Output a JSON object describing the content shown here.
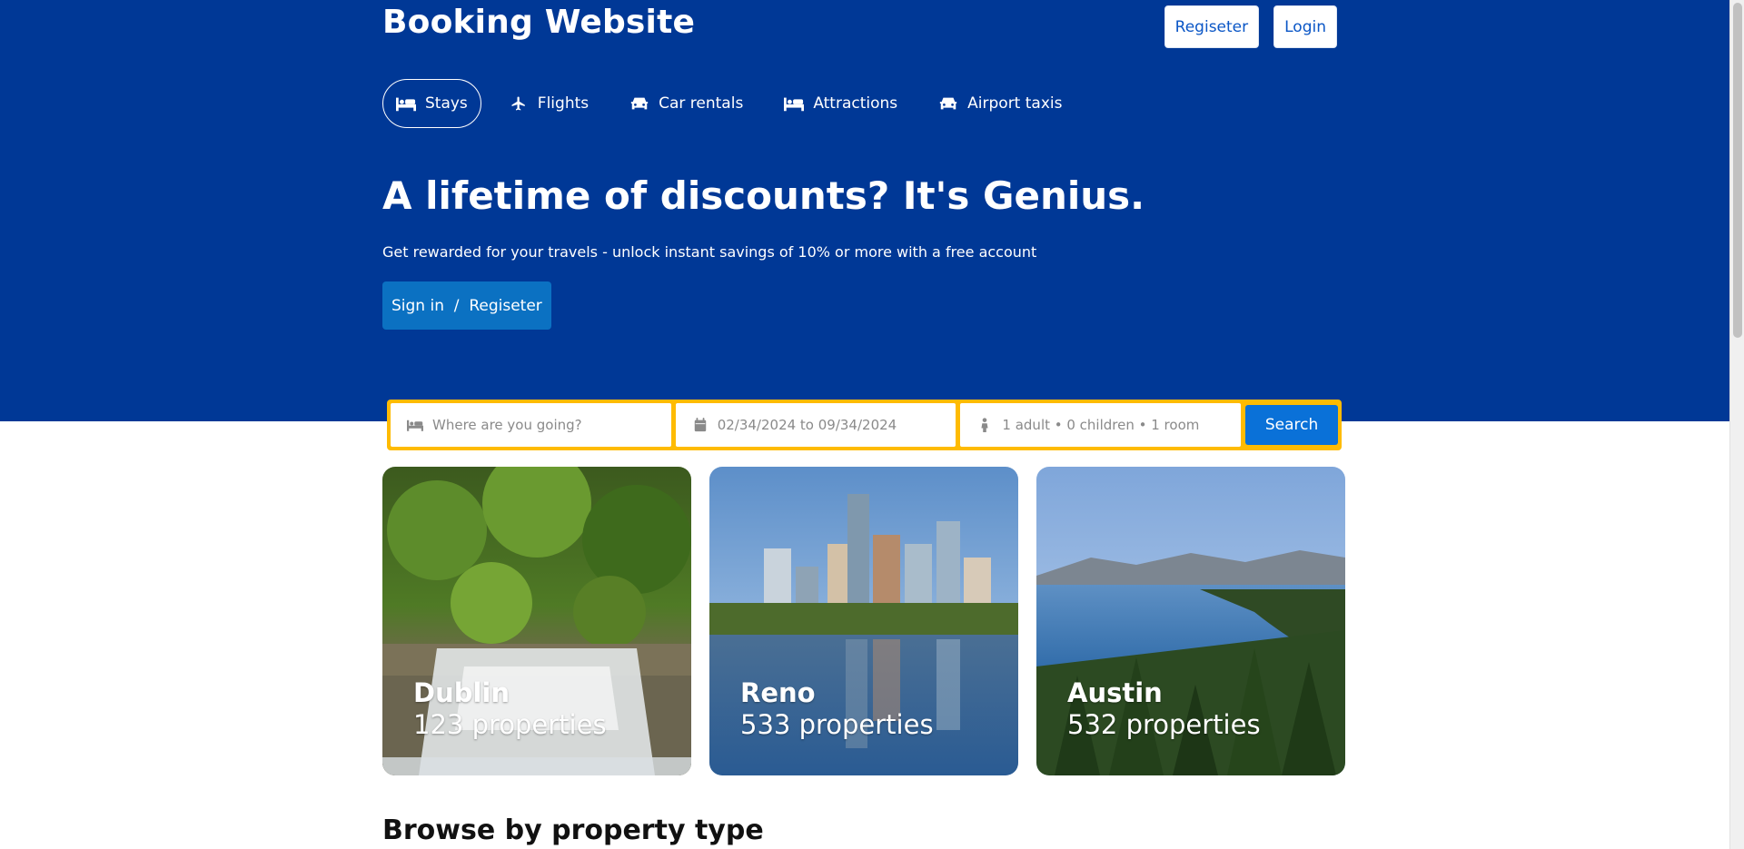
{
  "header": {
    "brand": "Booking Website",
    "register_label": "Regiseter",
    "login_label": "Login"
  },
  "nav": {
    "items": [
      {
        "label": "Stays",
        "icon": "bed-icon",
        "active": true
      },
      {
        "label": "Flights",
        "icon": "plane-icon",
        "active": false
      },
      {
        "label": "Car rentals",
        "icon": "car-icon",
        "active": false
      },
      {
        "label": "Attractions",
        "icon": "bed-icon",
        "active": false
      },
      {
        "label": "Airport taxis",
        "icon": "taxi-icon",
        "active": false
      }
    ]
  },
  "hero": {
    "title": "A lifetime of discounts? It's Genius.",
    "subtitle": "Get rewarded for your travels - unlock instant savings of 10% or more with a free account",
    "cta_label": "Sign in  /  Regiseter"
  },
  "search": {
    "destination_placeholder": "Where are you going?",
    "dates_value": "02/34/2024 to 09/34/2024",
    "guests_value": "1 adult • 0 children • 1 room",
    "button_label": "Search"
  },
  "destinations": [
    {
      "city": "Dublin",
      "properties": "123 properties",
      "scene": "waterfall-forest"
    },
    {
      "city": "Reno",
      "properties": "533 properties",
      "scene": "city-skyline-lake"
    },
    {
      "city": "Austin",
      "properties": "532 properties",
      "scene": "lake-mountains-pines"
    }
  ],
  "sections": {
    "browse_title": "Browse by property type"
  },
  "colors": {
    "brand_blue": "#003896",
    "cta_blue": "#0b71c2",
    "search_border": "#febb02",
    "search_button": "#0a71d8"
  }
}
